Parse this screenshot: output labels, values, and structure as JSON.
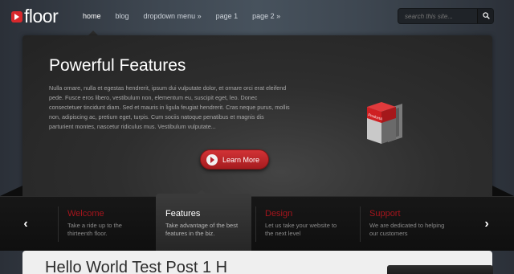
{
  "header": {
    "logo_text": "floor",
    "nav": [
      {
        "label": "home"
      },
      {
        "label": "blog"
      },
      {
        "label": "dropdown menu »"
      },
      {
        "label": "page 1"
      },
      {
        "label": "page 2 »"
      }
    ],
    "search_placeholder": "search this site..."
  },
  "slider": {
    "title": "Powerful Features",
    "text": "Nulla ornare, nulla et egestas hendrerit, ipsum dui vulputate dolor, et ornare orci erat eleifend pede. Fusce eros libero, vestibulum non, elementum eu, suscipit eget, leo. Donec consectetuer tincidunt diam. Sed et mauris in ligula feugiat hendrerit. Cras neque purus, mollis non, adipiscing ac, pretium eget, turpis. Cum sociis natoque penatibus et magnis dis parturient montes, nascetur ridiculus mus. Vestibulum vulputate...",
    "button_label": "Learn More",
    "product_label": "ProductA"
  },
  "thumbs": {
    "prev_icon": "‹",
    "next_icon": "›",
    "items": [
      {
        "title": "Welcome",
        "desc": "Take a ride up to the thirteenth floor."
      },
      {
        "title": "Features",
        "desc": "Take advantage of the best features in the biz."
      },
      {
        "title": "Design",
        "desc": "Let us take your website to the next level"
      },
      {
        "title": "Support",
        "desc": "We are dedicated to helping our customers"
      }
    ]
  },
  "content": {
    "post_title": "Hello World Test Post 1 H"
  },
  "colors": {
    "accent": "#d8282c",
    "thumb_title": "#a5151c"
  }
}
